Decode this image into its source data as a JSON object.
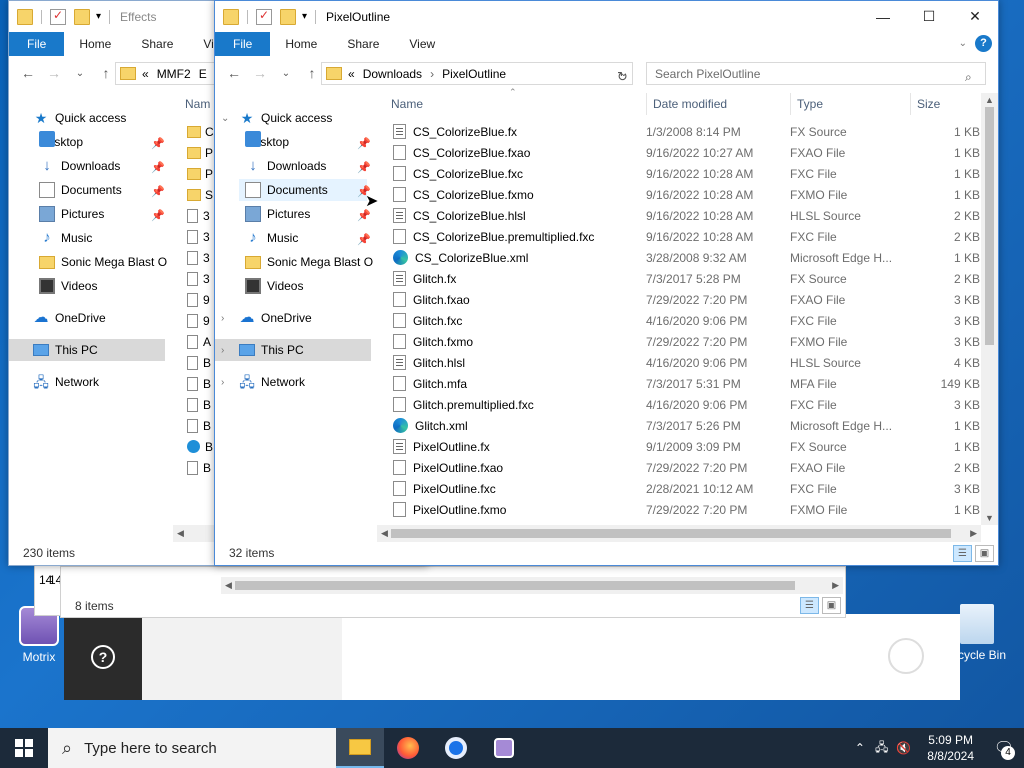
{
  "desktop": {
    "icons": [
      {
        "label": "Motrix"
      },
      {
        "label": "cycle Bin"
      }
    ]
  },
  "back_window": {
    "status_items": "8 items",
    "partial_text": "14",
    "help_symbol": "?"
  },
  "win_effects": {
    "title": "Effects",
    "tabs": [
      "File",
      "Home",
      "Share",
      "View"
    ],
    "address": {
      "prefix": "«",
      "crumbs": [
        "MMF2",
        "E"
      ]
    },
    "nav": [
      {
        "label": "Quick access",
        "icon": "star-icon",
        "pinned": false
      },
      {
        "label": "Desktop",
        "icon": "desktop-icon",
        "pinned": true
      },
      {
        "label": "Downloads",
        "icon": "download-icon",
        "pinned": true
      },
      {
        "label": "Documents",
        "icon": "documents-icon",
        "pinned": true
      },
      {
        "label": "Pictures",
        "icon": "pictures-icon",
        "pinned": true
      },
      {
        "label": "Music",
        "icon": "music-icon",
        "pinned": false
      },
      {
        "label": "Sonic Mega Blast O",
        "icon": "folder-icon",
        "pinned": false
      },
      {
        "label": "Videos",
        "icon": "videos-icon",
        "pinned": false
      },
      {
        "label": "OneDrive",
        "icon": "cloud-icon",
        "pinned": false
      },
      {
        "label": "This PC",
        "icon": "pc-icon",
        "pinned": false
      },
      {
        "label": "Network",
        "icon": "network-icon",
        "pinned": false
      }
    ],
    "col_name": "Nam",
    "file_letters": [
      "C",
      "P",
      "P",
      "S",
      "3",
      "3",
      "3",
      "3",
      "9",
      "9",
      "A",
      "B",
      "B",
      "B",
      "B",
      "B",
      "B"
    ],
    "status": "230 items"
  },
  "win_pixel": {
    "title": "PixelOutline",
    "tabs": [
      "File",
      "Home",
      "Share",
      "View"
    ],
    "address": {
      "prefix": "«",
      "crumbs": [
        "Downloads",
        "PixelOutline"
      ]
    },
    "search_placeholder": "Search PixelOutline",
    "nav": [
      {
        "label": "Quick access",
        "icon": "star-icon",
        "pinned": false,
        "expand": "⌄"
      },
      {
        "label": "Desktop",
        "icon": "desktop-icon",
        "pinned": true
      },
      {
        "label": "Downloads",
        "icon": "download-icon",
        "pinned": true
      },
      {
        "label": "Documents",
        "icon": "documents-icon",
        "pinned": true
      },
      {
        "label": "Pictures",
        "icon": "pictures-icon",
        "pinned": true
      },
      {
        "label": "Music",
        "icon": "music-icon",
        "pinned": true
      },
      {
        "label": "Sonic Mega Blast O",
        "icon": "folder-icon",
        "pinned": false
      },
      {
        "label": "Videos",
        "icon": "videos-icon",
        "pinned": false
      },
      {
        "label": "OneDrive",
        "icon": "cloud-icon",
        "pinned": false,
        "expand": "›"
      },
      {
        "label": "This PC",
        "icon": "pc-icon",
        "pinned": false,
        "expand": "›"
      },
      {
        "label": "Network",
        "icon": "network-icon",
        "pinned": false,
        "expand": "›"
      }
    ],
    "columns": [
      "Name",
      "Date modified",
      "Type",
      "Size"
    ],
    "files": [
      {
        "name": "CS_ColorizeBlue.fx",
        "date": "1/3/2008 8:14 PM",
        "type": "FX Source",
        "size": "1 KB",
        "icon": "source"
      },
      {
        "name": "CS_ColorizeBlue.fxao",
        "date": "9/16/2022 10:27 AM",
        "type": "FXAO File",
        "size": "1 KB",
        "icon": "file"
      },
      {
        "name": "CS_ColorizeBlue.fxc",
        "date": "9/16/2022 10:28 AM",
        "type": "FXC File",
        "size": "1 KB",
        "icon": "file"
      },
      {
        "name": "CS_ColorizeBlue.fxmo",
        "date": "9/16/2022 10:28 AM",
        "type": "FXMO File",
        "size": "1 KB",
        "icon": "file"
      },
      {
        "name": "CS_ColorizeBlue.hlsl",
        "date": "9/16/2022 10:28 AM",
        "type": "HLSL Source",
        "size": "2 KB",
        "icon": "source"
      },
      {
        "name": "CS_ColorizeBlue.premultiplied.fxc",
        "date": "9/16/2022 10:28 AM",
        "type": "FXC File",
        "size": "2 KB",
        "icon": "file"
      },
      {
        "name": "CS_ColorizeBlue.xml",
        "date": "3/28/2008 9:32 AM",
        "type": "Microsoft Edge H...",
        "size": "1 KB",
        "icon": "edge"
      },
      {
        "name": "Glitch.fx",
        "date": "7/3/2017 5:28 PM",
        "type": "FX Source",
        "size": "2 KB",
        "icon": "source"
      },
      {
        "name": "Glitch.fxao",
        "date": "7/29/2022 7:20 PM",
        "type": "FXAO File",
        "size": "3 KB",
        "icon": "file"
      },
      {
        "name": "Glitch.fxc",
        "date": "4/16/2020 9:06 PM",
        "type": "FXC File",
        "size": "3 KB",
        "icon": "file"
      },
      {
        "name": "Glitch.fxmo",
        "date": "7/29/2022 7:20 PM",
        "type": "FXMO File",
        "size": "3 KB",
        "icon": "file"
      },
      {
        "name": "Glitch.hlsl",
        "date": "4/16/2020 9:06 PM",
        "type": "HLSL Source",
        "size": "4 KB",
        "icon": "source"
      },
      {
        "name": "Glitch.mfa",
        "date": "7/3/2017 5:31 PM",
        "type": "MFA File",
        "size": "149 KB",
        "icon": "file"
      },
      {
        "name": "Glitch.premultiplied.fxc",
        "date": "4/16/2020 9:06 PM",
        "type": "FXC File",
        "size": "3 KB",
        "icon": "file"
      },
      {
        "name": "Glitch.xml",
        "date": "7/3/2017 5:26 PM",
        "type": "Microsoft Edge H...",
        "size": "1 KB",
        "icon": "edge"
      },
      {
        "name": "PixelOutline.fx",
        "date": "9/1/2009 3:09 PM",
        "type": "FX Source",
        "size": "1 KB",
        "icon": "source"
      },
      {
        "name": "PixelOutline.fxao",
        "date": "7/29/2022 7:20 PM",
        "type": "FXAO File",
        "size": "2 KB",
        "icon": "file"
      },
      {
        "name": "PixelOutline.fxc",
        "date": "2/28/2021 10:12 AM",
        "type": "FXC File",
        "size": "3 KB",
        "icon": "file"
      },
      {
        "name": "PixelOutline.fxmo",
        "date": "7/29/2022 7:20 PM",
        "type": "FXMO File",
        "size": "1 KB",
        "icon": "file"
      }
    ],
    "status": "32 items"
  },
  "taskbar": {
    "search_placeholder": "Type here to search",
    "time": "5:09 PM",
    "date": "8/8/2024",
    "notification_count": "4",
    "apps": [
      "file-explorer-icon",
      "firefox-icon",
      "chrome-icon",
      "motrix-icon"
    ]
  },
  "colors": {
    "accent": "#1979ca",
    "desktop_bg": "#1565b8",
    "taskbar": "#1c2a3a"
  }
}
